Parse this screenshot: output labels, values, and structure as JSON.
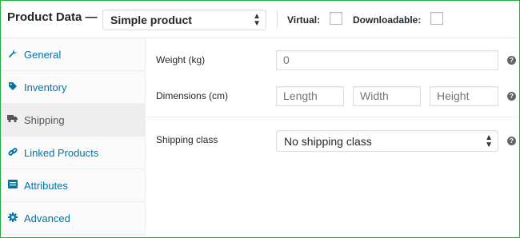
{
  "header": {
    "title": "Product Data —",
    "product_type": "Simple product",
    "virtual_label": "Virtual:",
    "downloadable_label": "Downloadable:"
  },
  "sidebar": {
    "items": [
      {
        "label": "General",
        "icon": "wrench-icon",
        "active": false
      },
      {
        "label": "Inventory",
        "icon": "tag-icon",
        "active": false
      },
      {
        "label": "Shipping",
        "icon": "truck-icon",
        "active": true
      },
      {
        "label": "Linked Products",
        "icon": "link-icon",
        "active": false
      },
      {
        "label": "Attributes",
        "icon": "list-icon",
        "active": false
      },
      {
        "label": "Advanced",
        "icon": "gear-icon",
        "active": false
      }
    ]
  },
  "shipping": {
    "weight_label": "Weight (kg)",
    "weight_placeholder": "0",
    "dimensions_label": "Dimensions (cm)",
    "length_placeholder": "Length",
    "width_placeholder": "Width",
    "height_placeholder": "Height",
    "class_label": "Shipping class",
    "class_value": "No shipping class"
  },
  "colors": {
    "accent_link": "#0073aa",
    "frame_border": "#20b33a",
    "active_tab_bg": "#eeeeee"
  }
}
